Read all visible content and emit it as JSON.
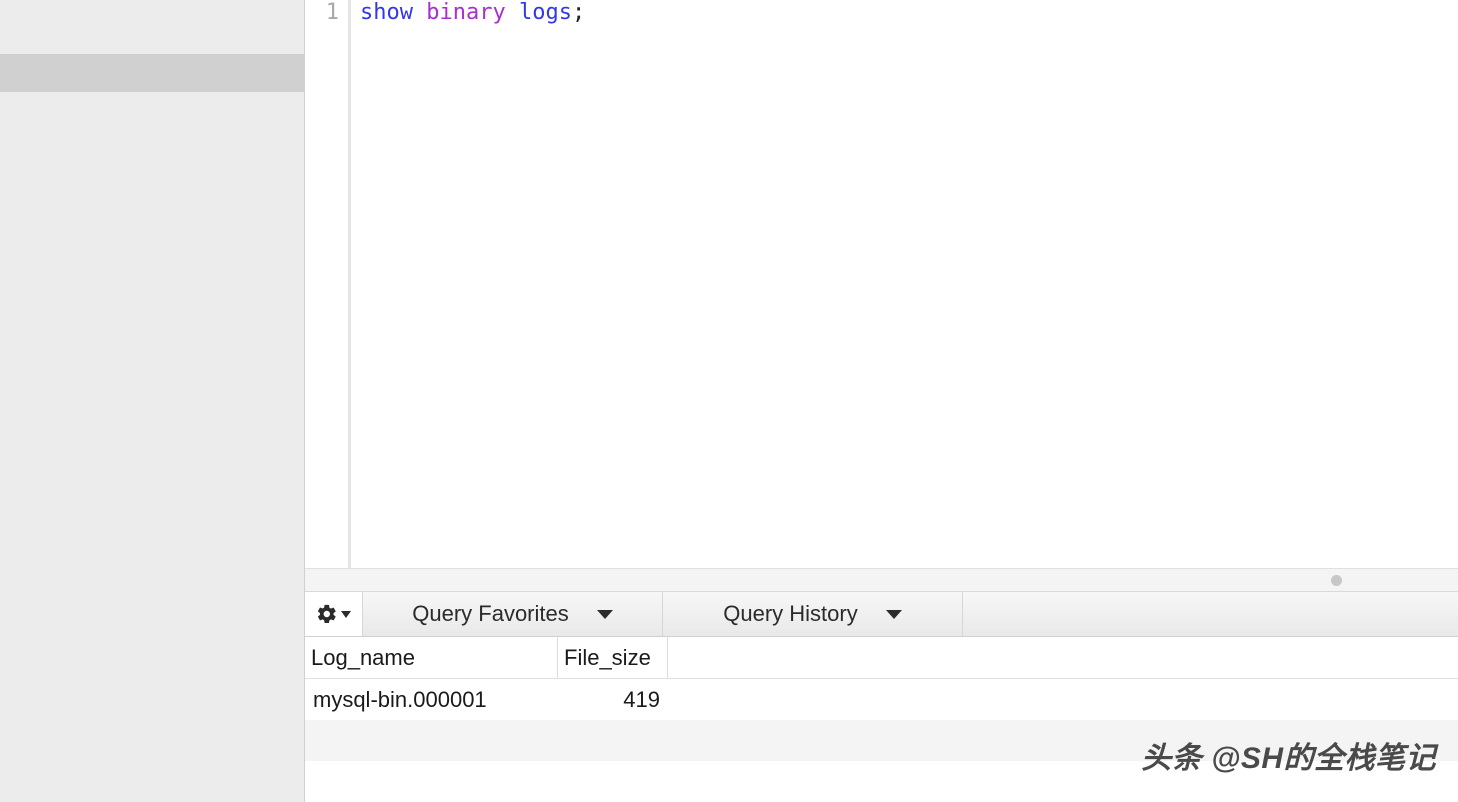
{
  "editor": {
    "line_number": "1",
    "code": {
      "kw1": "show",
      "kw2": "binary",
      "kw3": "logs",
      "punct": ";"
    }
  },
  "toolbar": {
    "favorites_label": "Query Favorites",
    "history_label": "Query History"
  },
  "results": {
    "columns": {
      "log_name": "Log_name",
      "file_size": "File_size"
    },
    "rows": [
      {
        "log_name": "mysql-bin.000001",
        "file_size": "419"
      }
    ]
  },
  "watermark": "头条 @SH的全栈笔记"
}
